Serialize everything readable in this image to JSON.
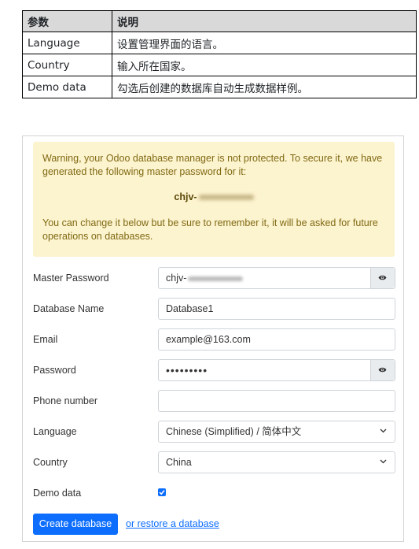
{
  "param_table": {
    "headers": [
      "参数",
      "说明"
    ],
    "rows": [
      [
        "Language",
        "设置管理界面的语言。"
      ],
      [
        "Country",
        "输入所在国家。"
      ],
      [
        "Demo data",
        "勾选后创建的数据库自动生成数据样例。"
      ]
    ]
  },
  "alert": {
    "line1": "Warning, your Odoo database manager is not protected. To secure it, we have generated the following master password for it:",
    "password_visible": "chjv-",
    "line2": "You can change it below but be sure to remember it, it will be asked for future operations on databases."
  },
  "form": {
    "master_password": {
      "label": "Master Password",
      "value_visible": "chjv-"
    },
    "database_name": {
      "label": "Database Name",
      "value": "Database1"
    },
    "email": {
      "label": "Email",
      "value": "example@163.com"
    },
    "password": {
      "label": "Password",
      "value": "•••••••••"
    },
    "phone": {
      "label": "Phone number",
      "value": ""
    },
    "language": {
      "label": "Language",
      "value": "Chinese (Simplified) / 简体中文"
    },
    "country": {
      "label": "Country",
      "value": "China"
    },
    "demo_data": {
      "label": "Demo data",
      "checked": true
    }
  },
  "actions": {
    "create_label": "Create database",
    "restore_label": "or restore a database"
  },
  "colors": {
    "primary": "#0d6efd",
    "alert_bg": "#fcf3cf",
    "alert_text": "#806a13",
    "table_header_bg": "#d9d9d9"
  },
  "icons": [
    "eye-icon",
    "chevron-down-icon",
    "checkmark-icon"
  ]
}
